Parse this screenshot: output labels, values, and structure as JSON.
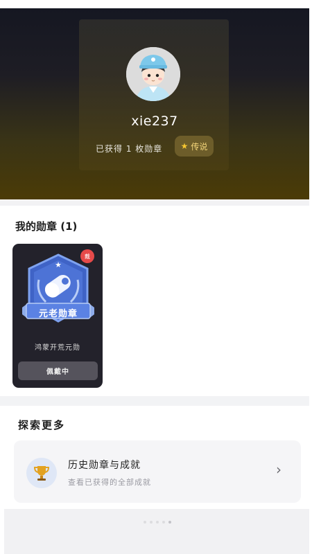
{
  "profile": {
    "username": "xie237",
    "badge_count_text": "已获得 1 枚勋章",
    "tier_label": "传说"
  },
  "my_badges": {
    "title": "我的勋章 (1)",
    "items": [
      {
        "emblem_text": "元老勋章",
        "name": "鸿蒙开荒元勋",
        "status_label": "佩戴中",
        "corner_badge": "戴"
      }
    ]
  },
  "explore": {
    "title": "探索更多",
    "row_title": "历史勋章与成就",
    "row_subtitle": "查看已获得的全部成就"
  },
  "pager": {
    "count": 5,
    "active": 4
  },
  "colors": {
    "accent": "#f6c631",
    "badge_card": "#23222b",
    "red_dot": "#e64a4a"
  }
}
